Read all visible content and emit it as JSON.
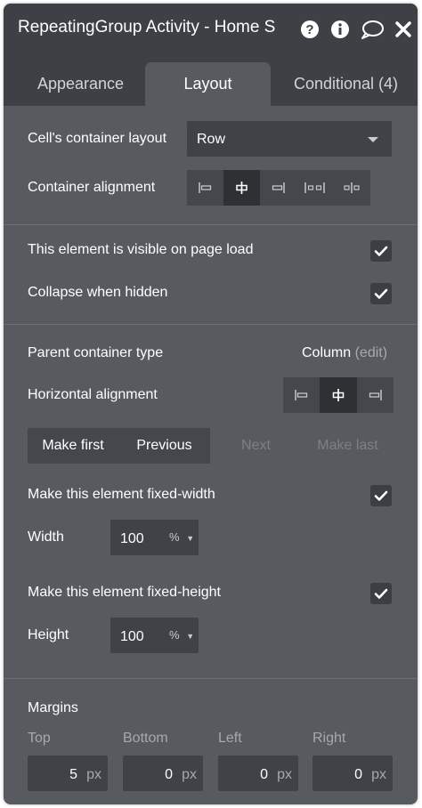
{
  "header": {
    "title": "RepeatingGroup Activity - Home S",
    "icons": [
      "help-icon",
      "info-icon",
      "comment-icon",
      "close-icon"
    ]
  },
  "tabs": [
    {
      "label": "Appearance",
      "active": false
    },
    {
      "label": "Layout",
      "active": true
    },
    {
      "label": "Conditional (4)",
      "active": false
    }
  ],
  "cell_layout": {
    "label": "Cell's container layout",
    "value": "Row"
  },
  "container_alignment": {
    "label": "Container alignment",
    "selected": "center"
  },
  "visibility": {
    "visible_on_load": {
      "label": "This element is visible on page load",
      "checked": true
    },
    "collapse_when_hidden": {
      "label": "Collapse when hidden",
      "checked": true
    }
  },
  "parent": {
    "label": "Parent container type",
    "value": "Column",
    "edit": "(edit)"
  },
  "horizontal_alignment": {
    "label": "Horizontal alignment",
    "selected": "center"
  },
  "order": {
    "make_first": "Make first",
    "previous": "Previous",
    "next": "Next",
    "make_last": "Make last"
  },
  "fixed_width": {
    "label": "Make this element fixed-width",
    "checked": true
  },
  "width": {
    "label": "Width",
    "value": "100",
    "unit": "%"
  },
  "fixed_height": {
    "label": "Make this element fixed-height",
    "checked": true
  },
  "height": {
    "label": "Height",
    "value": "100",
    "unit": "%"
  },
  "margins": {
    "label": "Margins",
    "top": {
      "label": "Top",
      "value": "5",
      "unit": "px"
    },
    "bottom": {
      "label": "Bottom",
      "value": "0",
      "unit": "px"
    },
    "left": {
      "label": "Left",
      "value": "0",
      "unit": "px"
    },
    "right": {
      "label": "Right",
      "value": "0",
      "unit": "px"
    }
  }
}
